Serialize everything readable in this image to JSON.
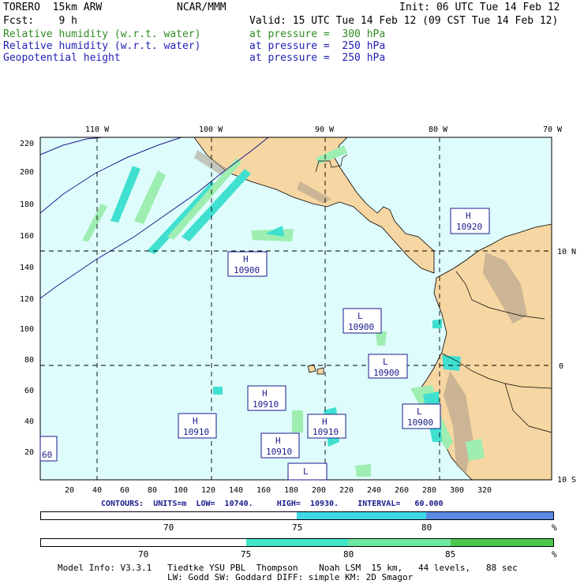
{
  "header": {
    "model": "TORERO  15km ARW",
    "center": "NCAR/MMM",
    "init": "Init: 06 UTC Tue 14 Feb 12",
    "fcst": "Fcst:    9 h",
    "valid": "Valid: 15 UTC Tue 14 Feb 12 (09 CST Tue 14 Feb 12)",
    "fields": [
      {
        "name": "Relative humidity (w.r.t. water)",
        "level": "at pressure =  300 hPa",
        "color": "#2e8b22"
      },
      {
        "name": "Relative humidity (w.r.t. water)",
        "level": "at pressure =  250 hPa",
        "color": "#1f1fb4"
      },
      {
        "name": "Geopotential height",
        "level": "at pressure =  250 hPa",
        "color": "#1f1fb4"
      }
    ]
  },
  "map": {
    "top_lon_labels": [
      "110 W",
      "100 W",
      "90 W",
      "80 W",
      "70 W"
    ],
    "right_lat_labels": [
      "10 N",
      "0",
      "10 S"
    ],
    "left_ticks": [
      "220",
      "200",
      "180",
      "160",
      "140",
      "120",
      "100",
      "80",
      "60",
      "40",
      "20"
    ],
    "bottom_ticks": [
      "20",
      "40",
      "60",
      "80",
      "100",
      "120",
      "140",
      "160",
      "180",
      "200",
      "220",
      "240",
      "260",
      "280",
      "300",
      "320"
    ],
    "colors": {
      "ocean": "#dffcfc",
      "land": "#f6d6a2",
      "rh_light": "#9deeb0",
      "rh_mid": "#40e0d0",
      "contour": "#1a1a8c"
    },
    "centers": [
      {
        "type": "H",
        "value": "10920"
      },
      {
        "type": "H",
        "value": "10900"
      },
      {
        "type": "L",
        "value": "10900"
      },
      {
        "type": "L",
        "value": "10900"
      },
      {
        "type": "H",
        "value": "10910"
      },
      {
        "type": "L",
        "value": "10900"
      },
      {
        "type": "H",
        "value": "10910"
      },
      {
        "type": "H",
        "value": "10910"
      },
      {
        "type": "H",
        "value": "10910"
      },
      {
        "type": "L",
        "value": ""
      }
    ],
    "edge_label": "60"
  },
  "contours_info": {
    "label": "CONTOURS:",
    "units": "UNITS=m",
    "low": "LOW=  10740.",
    "high": "HIGH=  10930.",
    "interval": "INTERVAL=   60.000"
  },
  "colorbar_250": {
    "labels": [
      "70",
      "75",
      "80",
      "%"
    ],
    "colors": [
      "#ffffff",
      "#40d8e8",
      "#5a8ae6"
    ]
  },
  "colorbar_300": {
    "labels": [
      "70",
      "75",
      "80",
      "85",
      "%"
    ],
    "colors": [
      "#ffffff",
      "#40e8c8",
      "#6ee8a0",
      "#4cc84c"
    ]
  },
  "footer": {
    "line1": "Model Info: V3.3.1   Tiedtke YSU PBL  Thompson    Noah LSM  15 km,   44 levels,   88 sec",
    "line2": "LW: Godd SW: Goddard DIFF: simple KM: 2D Smagor"
  }
}
